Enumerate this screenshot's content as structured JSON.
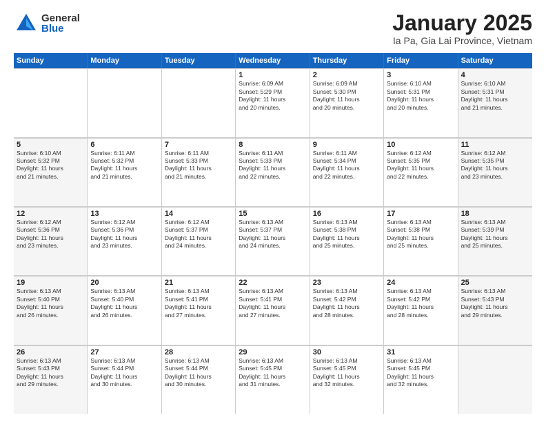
{
  "logo": {
    "general": "General",
    "blue": "Blue"
  },
  "title": {
    "month": "January 2025",
    "location": "Ia Pa, Gia Lai Province, Vietnam"
  },
  "weekdays": [
    "Sunday",
    "Monday",
    "Tuesday",
    "Wednesday",
    "Thursday",
    "Friday",
    "Saturday"
  ],
  "rows": [
    [
      {
        "day": "",
        "info": "",
        "shaded": false,
        "empty": true
      },
      {
        "day": "",
        "info": "",
        "shaded": false,
        "empty": true
      },
      {
        "day": "",
        "info": "",
        "shaded": false,
        "empty": true
      },
      {
        "day": "1",
        "info": "Sunrise: 6:09 AM\nSunset: 5:29 PM\nDaylight: 11 hours\nand 20 minutes.",
        "shaded": false
      },
      {
        "day": "2",
        "info": "Sunrise: 6:09 AM\nSunset: 5:30 PM\nDaylight: 11 hours\nand 20 minutes.",
        "shaded": false
      },
      {
        "day": "3",
        "info": "Sunrise: 6:10 AM\nSunset: 5:31 PM\nDaylight: 11 hours\nand 20 minutes.",
        "shaded": false
      },
      {
        "day": "4",
        "info": "Sunrise: 6:10 AM\nSunset: 5:31 PM\nDaylight: 11 hours\nand 21 minutes.",
        "shaded": true
      }
    ],
    [
      {
        "day": "5",
        "info": "Sunrise: 6:10 AM\nSunset: 5:32 PM\nDaylight: 11 hours\nand 21 minutes.",
        "shaded": true
      },
      {
        "day": "6",
        "info": "Sunrise: 6:11 AM\nSunset: 5:32 PM\nDaylight: 11 hours\nand 21 minutes.",
        "shaded": false
      },
      {
        "day": "7",
        "info": "Sunrise: 6:11 AM\nSunset: 5:33 PM\nDaylight: 11 hours\nand 21 minutes.",
        "shaded": false
      },
      {
        "day": "8",
        "info": "Sunrise: 6:11 AM\nSunset: 5:33 PM\nDaylight: 11 hours\nand 22 minutes.",
        "shaded": false
      },
      {
        "day": "9",
        "info": "Sunrise: 6:11 AM\nSunset: 5:34 PM\nDaylight: 11 hours\nand 22 minutes.",
        "shaded": false
      },
      {
        "day": "10",
        "info": "Sunrise: 6:12 AM\nSunset: 5:35 PM\nDaylight: 11 hours\nand 22 minutes.",
        "shaded": false
      },
      {
        "day": "11",
        "info": "Sunrise: 6:12 AM\nSunset: 5:35 PM\nDaylight: 11 hours\nand 23 minutes.",
        "shaded": true
      }
    ],
    [
      {
        "day": "12",
        "info": "Sunrise: 6:12 AM\nSunset: 5:36 PM\nDaylight: 11 hours\nand 23 minutes.",
        "shaded": true
      },
      {
        "day": "13",
        "info": "Sunrise: 6:12 AM\nSunset: 5:36 PM\nDaylight: 11 hours\nand 23 minutes.",
        "shaded": false
      },
      {
        "day": "14",
        "info": "Sunrise: 6:12 AM\nSunset: 5:37 PM\nDaylight: 11 hours\nand 24 minutes.",
        "shaded": false
      },
      {
        "day": "15",
        "info": "Sunrise: 6:13 AM\nSunset: 5:37 PM\nDaylight: 11 hours\nand 24 minutes.",
        "shaded": false
      },
      {
        "day": "16",
        "info": "Sunrise: 6:13 AM\nSunset: 5:38 PM\nDaylight: 11 hours\nand 25 minutes.",
        "shaded": false
      },
      {
        "day": "17",
        "info": "Sunrise: 6:13 AM\nSunset: 5:38 PM\nDaylight: 11 hours\nand 25 minutes.",
        "shaded": false
      },
      {
        "day": "18",
        "info": "Sunrise: 6:13 AM\nSunset: 5:39 PM\nDaylight: 11 hours\nand 25 minutes.",
        "shaded": true
      }
    ],
    [
      {
        "day": "19",
        "info": "Sunrise: 6:13 AM\nSunset: 5:40 PM\nDaylight: 11 hours\nand 26 minutes.",
        "shaded": true
      },
      {
        "day": "20",
        "info": "Sunrise: 6:13 AM\nSunset: 5:40 PM\nDaylight: 11 hours\nand 26 minutes.",
        "shaded": false
      },
      {
        "day": "21",
        "info": "Sunrise: 6:13 AM\nSunset: 5:41 PM\nDaylight: 11 hours\nand 27 minutes.",
        "shaded": false
      },
      {
        "day": "22",
        "info": "Sunrise: 6:13 AM\nSunset: 5:41 PM\nDaylight: 11 hours\nand 27 minutes.",
        "shaded": false
      },
      {
        "day": "23",
        "info": "Sunrise: 6:13 AM\nSunset: 5:42 PM\nDaylight: 11 hours\nand 28 minutes.",
        "shaded": false
      },
      {
        "day": "24",
        "info": "Sunrise: 6:13 AM\nSunset: 5:42 PM\nDaylight: 11 hours\nand 28 minutes.",
        "shaded": false
      },
      {
        "day": "25",
        "info": "Sunrise: 6:13 AM\nSunset: 5:43 PM\nDaylight: 11 hours\nand 29 minutes.",
        "shaded": true
      }
    ],
    [
      {
        "day": "26",
        "info": "Sunrise: 6:13 AM\nSunset: 5:43 PM\nDaylight: 11 hours\nand 29 minutes.",
        "shaded": true
      },
      {
        "day": "27",
        "info": "Sunrise: 6:13 AM\nSunset: 5:44 PM\nDaylight: 11 hours\nand 30 minutes.",
        "shaded": false
      },
      {
        "day": "28",
        "info": "Sunrise: 6:13 AM\nSunset: 5:44 PM\nDaylight: 11 hours\nand 30 minutes.",
        "shaded": false
      },
      {
        "day": "29",
        "info": "Sunrise: 6:13 AM\nSunset: 5:45 PM\nDaylight: 11 hours\nand 31 minutes.",
        "shaded": false
      },
      {
        "day": "30",
        "info": "Sunrise: 6:13 AM\nSunset: 5:45 PM\nDaylight: 11 hours\nand 32 minutes.",
        "shaded": false
      },
      {
        "day": "31",
        "info": "Sunrise: 6:13 AM\nSunset: 5:45 PM\nDaylight: 11 hours\nand 32 minutes.",
        "shaded": false
      },
      {
        "day": "",
        "info": "",
        "shaded": true,
        "empty": true
      }
    ]
  ]
}
